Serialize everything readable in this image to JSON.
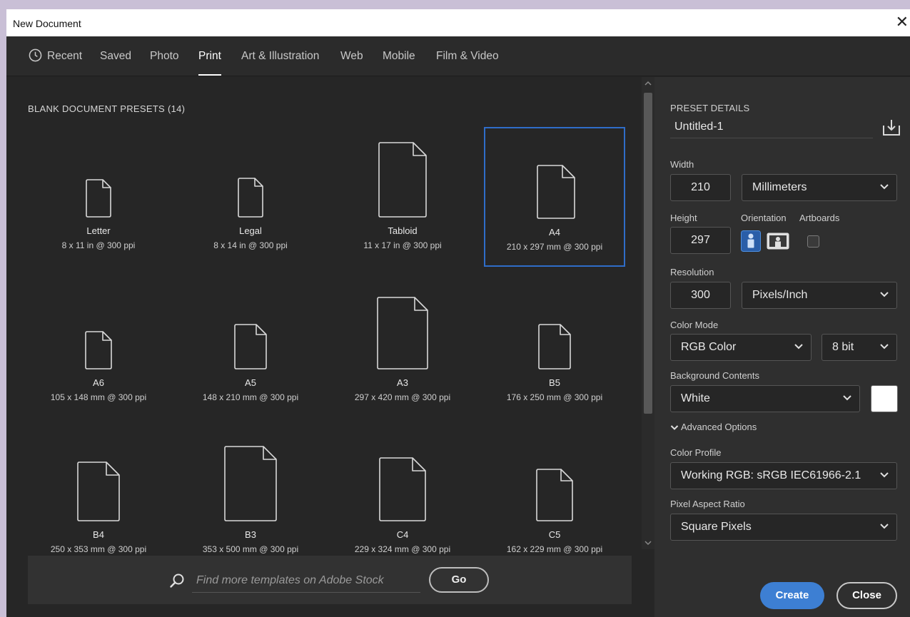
{
  "window": {
    "title": "New Document",
    "close_glyph": "✕"
  },
  "tabs": [
    {
      "label": "Recent",
      "icon": "clock-icon"
    },
    {
      "label": "Saved"
    },
    {
      "label": "Photo"
    },
    {
      "label": "Print",
      "active": true
    },
    {
      "label": "Art & Illustration"
    },
    {
      "label": "Web"
    },
    {
      "label": "Mobile"
    },
    {
      "label": "Film & Video"
    }
  ],
  "presets": {
    "section_label": "BLANK DOCUMENT PRESETS",
    "count": "(14)",
    "items": [
      {
        "name": "Letter",
        "dims": "8 x 11 in @ 300 ppi"
      },
      {
        "name": "Legal",
        "dims": "8 x 14 in @ 300 ppi"
      },
      {
        "name": "Tabloid",
        "dims": "11 x 17 in @ 300 ppi"
      },
      {
        "name": "A4",
        "dims": "210 x 297 mm @ 300 ppi",
        "selected": true
      },
      {
        "name": "A6",
        "dims": "105 x 148 mm @ 300 ppi"
      },
      {
        "name": "A5",
        "dims": "148 x 210 mm @ 300 ppi"
      },
      {
        "name": "A3",
        "dims": "297 x 420 mm @ 300 ppi"
      },
      {
        "name": "B5",
        "dims": "176 x 250 mm @ 300 ppi"
      },
      {
        "name": "B4",
        "dims": "250 x 353 mm @ 300 ppi"
      },
      {
        "name": "B3",
        "dims": "353 x 500 mm @ 300 ppi"
      },
      {
        "name": "C4",
        "dims": "229 x 324 mm @ 300 ppi"
      },
      {
        "name": "C5",
        "dims": "162 x 229 mm @ 300 ppi"
      }
    ]
  },
  "search": {
    "placeholder": "Find more templates on Adobe Stock",
    "go_label": "Go"
  },
  "details": {
    "header": "PRESET DETAILS",
    "doc_name": "Untitled-1",
    "width_label": "Width",
    "width_value": "210",
    "width_unit": "Millimeters",
    "height_label": "Height",
    "height_value": "297",
    "orientation_label": "Orientation",
    "artboards_label": "Artboards",
    "artboards_checked": false,
    "orientation_selected": "portrait",
    "resolution_label": "Resolution",
    "resolution_value": "300",
    "resolution_unit": "Pixels/Inch",
    "color_mode_label": "Color Mode",
    "color_mode": "RGB Color",
    "bit_depth": "8 bit",
    "bg_label": "Background Contents",
    "bg_value": "White",
    "bg_swatch_color": "#ffffff",
    "advanced_label": "Advanced Options",
    "color_profile_label": "Color Profile",
    "color_profile": "Working RGB: sRGB IEC61966-2.1",
    "pixel_aspect_label": "Pixel Aspect Ratio",
    "pixel_aspect": "Square Pixels",
    "create_label": "Create",
    "close_label": "Close"
  },
  "colors": {
    "accent": "#3d7fd3",
    "selection_border": "#3f7fd6",
    "panel_bg": "#262626",
    "details_bg": "#2f2f2f"
  }
}
